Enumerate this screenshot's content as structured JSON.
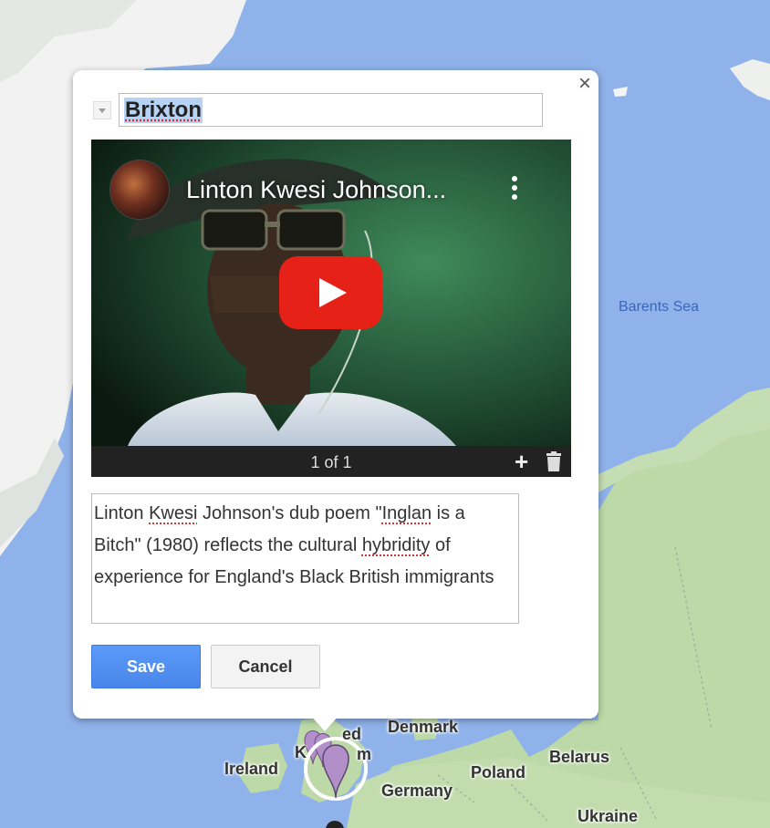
{
  "popup": {
    "title": "Brixton",
    "close_label": "×",
    "video": {
      "title": "Linton Kwesi Johnson...",
      "counter": "1 of 1",
      "add_label": "+"
    },
    "description": {
      "part1": "Linton ",
      "part2": "Kwesi",
      "part3": " Johnson's dub poem \"",
      "part4": "Inglan",
      "part5": " is a Bitch\" (1980) reflects the cultural ",
      "part6": "hybridity",
      "part7": " of experience for England's Black British immigrants"
    },
    "save_label": "Save",
    "cancel_label": "Cancel"
  },
  "map": {
    "labels": {
      "barents_sea": "Barents Sea",
      "denmark": "Denmark",
      "belarus": "Belarus",
      "ireland": "Ireland",
      "poland": "Poland",
      "germany": "Germany",
      "ukraine": "Ukraine",
      "uk_partial_1": "ed",
      "uk_partial_2": "K",
      "uk_partial_3": "m"
    },
    "colors": {
      "sea": "#8fb2ea",
      "land": "#bcd9a7",
      "ice": "#f2f3f2",
      "marker": "#b38fc9",
      "selected_marker_ring": "#ffffff"
    }
  },
  "accent": {
    "save_button": "#4d90fe",
    "youtube_red": "#e62117"
  }
}
